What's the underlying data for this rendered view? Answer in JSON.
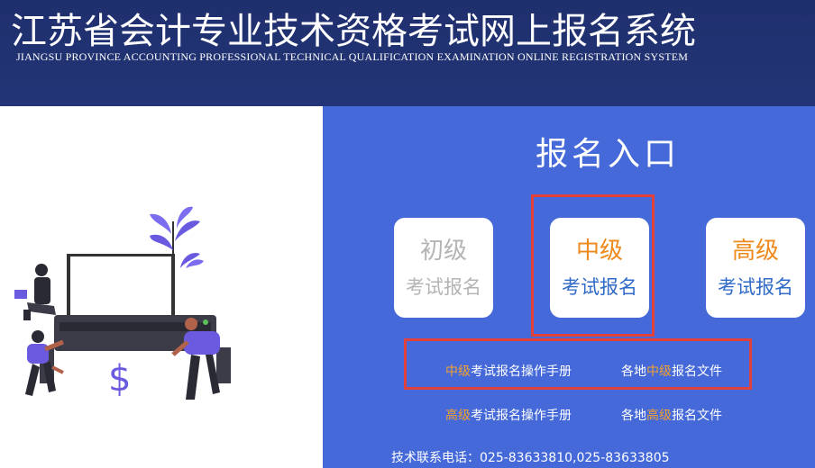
{
  "header": {
    "title": "江苏省会计专业技术资格考试网上报名系统",
    "subtitle": "JIANGSU PROVINCE ACCOUNTING PROFESSIONAL TECHNICAL QUALIFICATION EXAMINATION ONLINE REGISTRATION SYSTEM"
  },
  "illustration": {
    "icon": "people-working-illustration",
    "dollar_symbol": "$"
  },
  "portal": {
    "title": "报名入口",
    "cards": [
      {
        "level": "初级",
        "action": "考试报名",
        "state": "disabled"
      },
      {
        "level": "中级",
        "action": "考试报名",
        "state": "active"
      },
      {
        "level": "高级",
        "action": "考试报名",
        "state": "active"
      }
    ],
    "links": {
      "mid_manual": {
        "highlight": "中级",
        "text": "考试报名操作手册"
      },
      "mid_docs": {
        "prefix": "各地",
        "highlight": "中级",
        "text": "报名文件"
      },
      "senior_manual": {
        "highlight": "高级",
        "text": "考试报名操作手册"
      },
      "senior_docs": {
        "prefix": "各地",
        "highlight": "高级",
        "text": "报名文件"
      }
    },
    "contact": "技术联系电话：025-83633810,025-83633805"
  },
  "colors": {
    "header_bg": "#1f2f6e",
    "panel_bg": "#4569d8",
    "accent_orange": "#ee8a1c",
    "link_orange": "#f3a12f",
    "action_blue": "#2f6ac8",
    "highlight_red": "#e0413d",
    "disabled_gray": "#b4b4b4"
  }
}
